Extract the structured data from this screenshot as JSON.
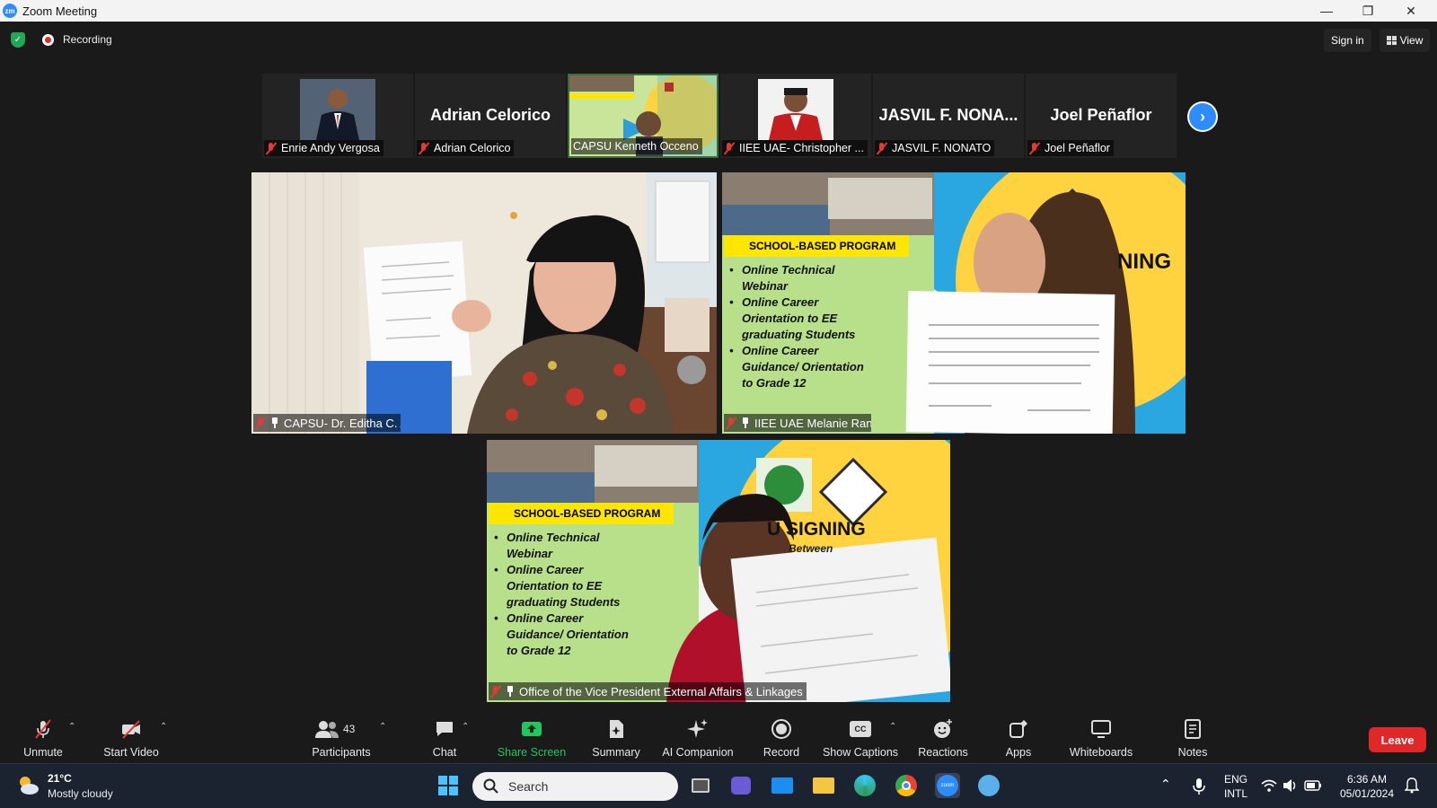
{
  "window": {
    "title": "Zoom Meeting",
    "app_icon": "zm",
    "controls": [
      "minimize-icon",
      "restore-icon",
      "close-icon"
    ]
  },
  "topbar": {
    "recording_label": "Recording",
    "signin_label": "Sign in",
    "view_label": "View"
  },
  "strip": [
    {
      "display": "photo",
      "label": "Enrie Andy Vergosa",
      "muted": true
    },
    {
      "display": "name",
      "big_name": "Adrian Celorico",
      "label": "Adrian Celorico",
      "muted": true
    },
    {
      "display": "video",
      "label": "CAPSU Kenneth Occeno",
      "muted": false
    },
    {
      "display": "photo",
      "label": "IIEE UAE- Christopher ...",
      "muted": true
    },
    {
      "display": "name",
      "big_name": "JASVIL F. NONA...",
      "label": "JASVIL F. NONATO",
      "muted": true
    },
    {
      "display": "name",
      "big_name": "Joel Peñaflor",
      "label": "Joel Peñaflor",
      "muted": true
    }
  ],
  "main_videos": [
    {
      "label": "CAPSU- Dr. Editha C. Alfon",
      "muted": true,
      "pinned": true
    },
    {
      "label": "IIEE UAE Melanie Rances",
      "muted": true,
      "pinned": true
    },
    {
      "label": "Office of the Vice President External Affairs & Linkages",
      "muted": true,
      "pinned": true
    }
  ],
  "slide": {
    "banner": "SCHOOL-BASED PROGRAM",
    "bullets": [
      "Online Technical Webinar",
      "Online Career Orientation to EE graduating Students",
      "Online Career Guidance/ Orientation to Grade 12"
    ],
    "signing_text_a": "NING",
    "signing_text_b": "U SIGNING",
    "between": "Between",
    "small_title": "U SIGNING"
  },
  "toolbar": {
    "unmute": "Unmute",
    "start_video": "Start Video",
    "participants": "Participants",
    "participant_count": "43",
    "chat": "Chat",
    "share_screen": "Share Screen",
    "summary": "Summary",
    "ai_companion": "AI Companion",
    "record": "Record",
    "show_captions": "Show Captions",
    "reactions": "Reactions",
    "apps": "Apps",
    "whiteboards": "Whiteboards",
    "notes": "Notes",
    "leave": "Leave",
    "accent_green": "#22c55e",
    "leave_color": "#e02828"
  },
  "taskbar": {
    "temperature": "21°C",
    "weather": "Mostly cloudy",
    "search_placeholder": "Search",
    "lang_top": "ENG",
    "lang_bottom": "INTL",
    "time": "6:36 AM",
    "date": "05/01/2024"
  }
}
